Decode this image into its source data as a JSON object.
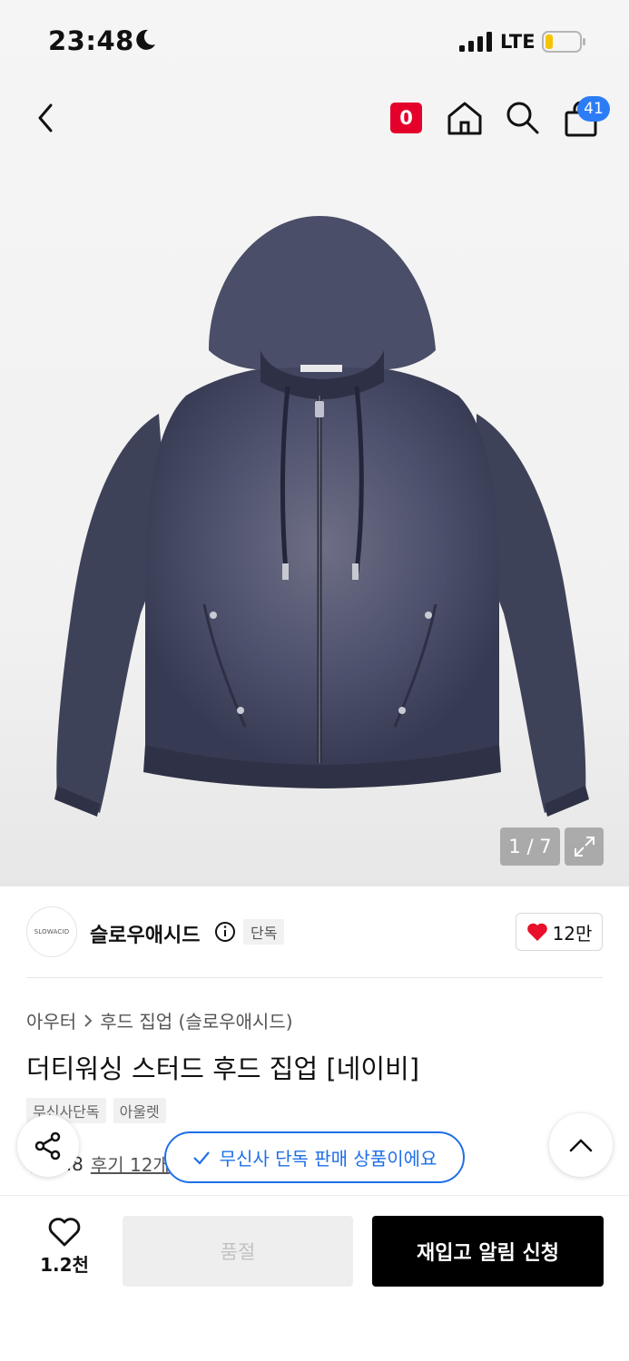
{
  "status_bar": {
    "time": "23:48",
    "network": "LTE"
  },
  "nav": {
    "notification_count": "0",
    "cart_count": "41"
  },
  "gallery": {
    "pager": "1 / 7"
  },
  "brand": {
    "logo_text": "SLOWACID",
    "name": "슬로우애시드",
    "exclusive_label": "단독",
    "like_count": "12만"
  },
  "breadcrumb": {
    "category": "아우터",
    "subcategory": "후드 집업 (슬로우애시드)"
  },
  "product": {
    "title": "더티워싱 스터드 후드 집업 [네이비]"
  },
  "tags": [
    {
      "label": "무신사단독"
    },
    {
      "label": "아울렛"
    }
  ],
  "rating": {
    "score": "4.8",
    "reviews": "후기 12개"
  },
  "toast": {
    "message": "무신사 단독 판매 상품이에요"
  },
  "bottom": {
    "wish_count": "1.2천",
    "soldout_label": "품절",
    "restock_label": "재입고 알림 신청"
  },
  "colors": {
    "accent_red": "#e4002b",
    "cart_badge": "#2c7cf6",
    "toast_blue": "#1f6fe8",
    "hoodie_navy": "#3b405a"
  }
}
